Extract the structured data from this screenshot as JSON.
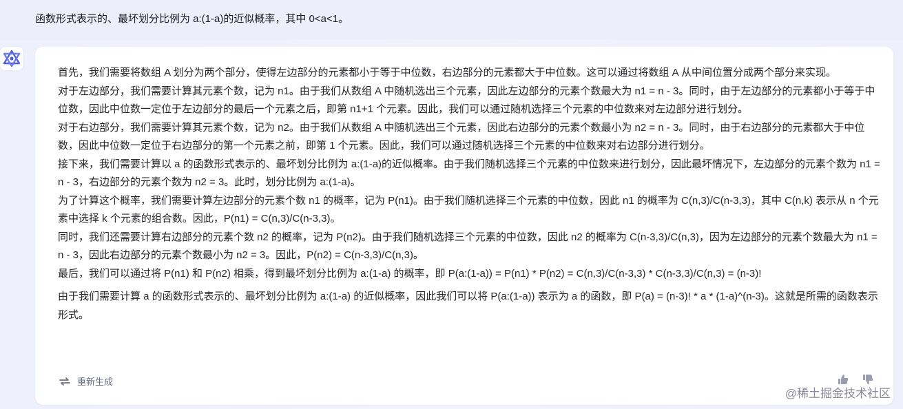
{
  "question": {
    "text": "函数形式表示的、最坏划分比例为 a:(1-a)的近似概率，其中 0<a<1。"
  },
  "answer": {
    "paragraphs": [
      "首先，我们需要将数组 A 划分为两个部分，使得左边部分的元素都小于等于中位数，右边部分的元素都大于中位数。这可以通过将数组 A 从中间位置分成两个部分来实现。",
      "对于左边部分，我们需要计算其元素个数，记为 n1。由于我们从数组 A 中随机选出三个元素，因此左边部分的元素个数最大为 n1 = n - 3。同时，由于左边部分的元素都小于等于中位数，因此中位数一定位于左边部分的最后一个元素之后，即第 n1+1 个元素。因此，我们可以通过随机选择三个元素的中位数来对左边部分进行划分。",
      "对于右边部分，我们需要计算其元素个数，记为 n2。由于我们从数组 A 中随机选出三个元素，因此右边部分的元素个数最小为 n2 = n - 3。同时，由于右边部分的元素都大于中位数，因此中位数一定位于右边部分的第一个元素之前，即第 1 个元素。因此，我们可以通过随机选择三个元素的中位数来对右边部分进行划分。",
      "接下来，我们需要计算以 a 的函数形式表示的、最坏划分比例为 a:(1-a)的近似概率。由于我们随机选择三个元素的中位数来进行划分，因此最坏情况下，左边部分的元素个数为 n1 = n - 3，右边部分的元素个数为 n2 = 3。此时，划分比例为 a:(1-a)。",
      "为了计算这个概率，我们需要计算左边部分的元素个数 n1 的概率，记为 P(n1)。由于我们随机选择三个元素的中位数，因此 n1 的概率为 C(n,3)/C(n-3,3)，其中 C(n,k) 表示从 n 个元素中选择 k 个元素的组合数。因此，P(n1) = C(n,3)/C(n-3,3)。",
      "同时，我们还需要计算右边部分的元素个数 n2 的概率，记为 P(n2)。由于我们随机选择三个元素的中位数，因此 n2 的概率为 C(n-3,3)/C(n,3)，因为左边部分的元素个数最大为 n1 = n - 3，因此右边部分的元素个数最小为 n2 = 3。因此，P(n2) = C(n-3,3)/C(n,3)。",
      "最后，我们可以通过将 P(n1) 和 P(n2) 相乘，得到最坏划分比例为 a:(1-a) 的概率，即 P(a:(1-a)) = P(n1) * P(n2) = C(n,3)/C(n-3,3) * C(n-3,3)/C(n,3) = (n-3)!",
      "由于我们需要计算 a 的函数形式表示的、最坏划分比例为 a:(1-a) 的近似概率，因此我们可以将 P(a:(1-a)) 表示为 a 的函数，即 P(a) = (n-3)! * a * (1-a)^(n-3)。这就是所需的函数表示形式。"
    ],
    "regenerate_label": "重新生成"
  },
  "icons": {
    "avatar": "assistant-logo-icon",
    "regenerate": "refresh-icon",
    "like": "thumbs-up-icon",
    "dislike": "thumbs-down-icon"
  },
  "colors": {
    "accent": "#4f5fd6",
    "background": "#eef0fb",
    "card": "#ffffff",
    "muted": "#6b6f80"
  },
  "watermark": {
    "site": "@稀土掘金技术社区"
  }
}
